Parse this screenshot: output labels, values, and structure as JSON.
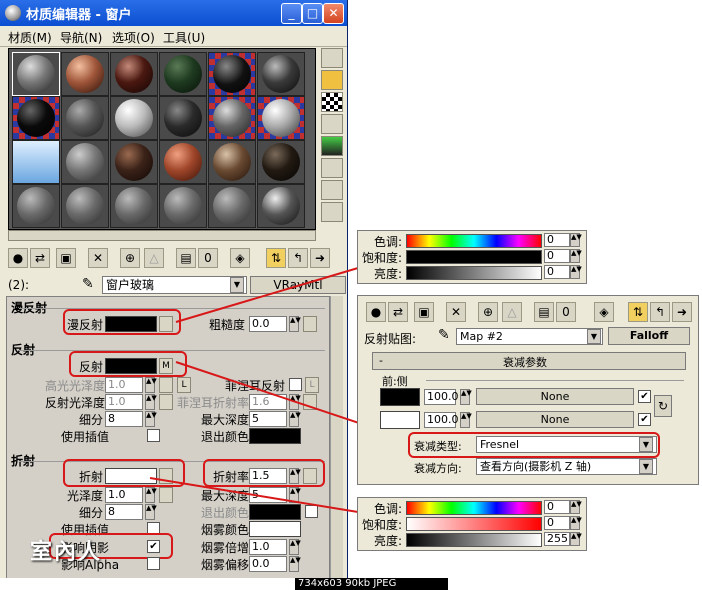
{
  "window": {
    "title": "材质编辑器 - 窗户",
    "menus": [
      "材质(M)",
      "导航(N)",
      "选项(O)",
      "工具(U)"
    ]
  },
  "name_bar": {
    "slot_label": "(2):",
    "material_name": "窗户玻璃",
    "material_type": "VRayMtl"
  },
  "diffuse": {
    "section": "漫反射",
    "diffuse_label": "漫反射",
    "roughness_label": "粗糙度",
    "roughness_value": "0.0"
  },
  "reflection": {
    "section": "反射",
    "reflect_label": "反射",
    "reflect_map_mark": "M",
    "hilight_gloss_label": "高光光泽度",
    "hilight_gloss_value": "1.0",
    "lock_mark": "L",
    "fresnel_label": "菲涅耳反射",
    "fresnel_lock": "L",
    "refl_gloss_label": "反射光泽度",
    "refl_gloss_value": "1.0",
    "fresnel_ior_label": "菲涅耳折射率",
    "fresnel_ior_value": "1.6",
    "subdivs_label": "细分",
    "subdivs_value": "8",
    "max_depth_label": "最大深度",
    "max_depth_value": "5",
    "interp_label": "使用插值",
    "exit_color_label": "退出颜色"
  },
  "refraction": {
    "section": "折射",
    "refract_label": "折射",
    "ior_label": "折射率",
    "ior_value": "1.5",
    "gloss_label": "光泽度",
    "gloss_value": "1.0",
    "max_depth_label": "最大深度",
    "max_depth_value": "5",
    "subdivs_label": "细分",
    "subdivs_value": "8",
    "exit_color_label": "退出颜色",
    "interp_label": "使用插值",
    "fog_color_label": "烟雾颜色",
    "affect_shadows_label": "影响阴影",
    "fog_mult_label": "烟雾倍增",
    "fog_mult_value": "1.0",
    "affect_alpha_label": "影响Alpha",
    "fog_bias_label": "烟雾偏移",
    "fog_bias_value": "0.0"
  },
  "hsv_top": {
    "hue_label": "色调:",
    "hue_value": "0",
    "sat_label": "饱和度:",
    "sat_value": "0",
    "val_label": "亮度:",
    "val_value": "0"
  },
  "falloff_panel": {
    "map_label": "反射贴图:",
    "map_name": "Map #2",
    "map_type": "Falloff",
    "rollout_title": "衰减参数",
    "collapse_mark": "-",
    "group_label": "前:侧",
    "front_amount": "100.0",
    "front_map": "None",
    "side_amount": "100.0",
    "side_map": "None",
    "falloff_type_label": "衰减类型:",
    "falloff_type_value": "Fresnel",
    "falloff_dir_label": "衰减方向:",
    "falloff_dir_value": "查看方向(摄影机 Z 轴)"
  },
  "hsv_bottom": {
    "hue_label": "色调:",
    "hue_value": "0",
    "sat_label": "饱和度:",
    "sat_value": "0",
    "val_label": "亮度:",
    "val_value": "255"
  },
  "watermark": "室內人",
  "status_text": "734x603  90kb  JPEG"
}
